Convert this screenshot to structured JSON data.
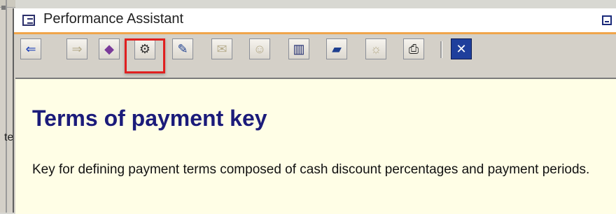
{
  "window": {
    "title": "Performance Assistant"
  },
  "toolbar": {
    "buttons": [
      {
        "name": "back-button",
        "icon": "arrow-left-icon",
        "glyph": "⇐",
        "color": "#1c3fb8",
        "enabled": true
      },
      {
        "name": "forward-button",
        "icon": "arrow-right-icon",
        "glyph": "⇒",
        "color": "#b7ad8e",
        "enabled": false
      },
      {
        "name": "application-help-button",
        "icon": "book-icon",
        "glyph": "◆",
        "color": "#7a3a9a",
        "enabled": true
      },
      {
        "name": "technical-info-button",
        "icon": "technical-info-icon",
        "glyph": "⚙",
        "color": "#333333",
        "enabled": true
      },
      {
        "name": "edit-note-button",
        "icon": "pencil-note-icon",
        "glyph": "✎",
        "color": "#1e3f8f",
        "enabled": true
      },
      {
        "name": "notes-button",
        "icon": "notes-icon",
        "glyph": "✉",
        "color": "#b7ad8e",
        "enabled": false
      },
      {
        "name": "user-notes-button",
        "icon": "user-note-icon",
        "glyph": "☺",
        "color": "#b7ad8e",
        "enabled": false
      },
      {
        "name": "glossary-button",
        "icon": "open-book-icon",
        "glyph": "▥",
        "color": "#1e2a6f",
        "enabled": true
      },
      {
        "name": "display-options-button",
        "icon": "display-icon",
        "glyph": "▰",
        "color": "#1e3f8f",
        "enabled": true
      },
      {
        "name": "settings-button",
        "icon": "settings-icon",
        "glyph": "☼",
        "color": "#b7ad8e",
        "enabled": false
      },
      {
        "name": "print-button",
        "icon": "printer-icon",
        "glyph": "⎙",
        "color": "#222222",
        "enabled": true
      },
      {
        "name": "close-button",
        "icon": "close-icon",
        "glyph": "✕",
        "color": "#ffffff",
        "enabled": true
      }
    ]
  },
  "content": {
    "heading": "Terms of payment key",
    "body": "Key for defining payment terms composed of cash discount percentages and payment periods."
  },
  "colors": {
    "accent_underline": "#f0a54b",
    "heading": "#1b1b7a",
    "background": "#fffee6",
    "highlight": "#e02020"
  },
  "background": {
    "partial_text": "te"
  }
}
